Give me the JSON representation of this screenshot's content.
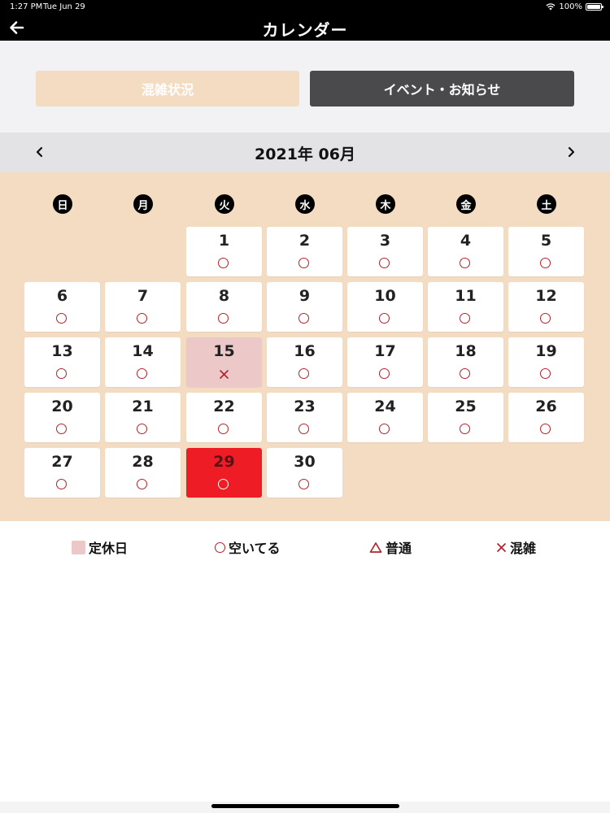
{
  "status_bar": {
    "time": "1:27 PM",
    "date": "Tue Jun 29",
    "battery": "100%",
    "battery_level": 1.0
  },
  "nav": {
    "title": "カレンダー",
    "back_icon": "arrow-left-icon"
  },
  "tabs": [
    {
      "label": "混雑状況",
      "selected": true
    },
    {
      "label": "イベント・お知らせ",
      "selected": false
    }
  ],
  "month": {
    "title": "2021年 06月",
    "prev_icon": "chevron-left-icon",
    "next_icon": "chevron-right-icon"
  },
  "weekdays": [
    "日",
    "月",
    "火",
    "水",
    "木",
    "金",
    "土"
  ],
  "first_weekday_index": 2,
  "days": [
    {
      "day": "1",
      "status": "open"
    },
    {
      "day": "2",
      "status": "open"
    },
    {
      "day": "3",
      "status": "open"
    },
    {
      "day": "4",
      "status": "open"
    },
    {
      "day": "5",
      "status": "open"
    },
    {
      "day": "6",
      "status": "open"
    },
    {
      "day": "7",
      "status": "open"
    },
    {
      "day": "8",
      "status": "open"
    },
    {
      "day": "9",
      "status": "open"
    },
    {
      "day": "10",
      "status": "open"
    },
    {
      "day": "11",
      "status": "open"
    },
    {
      "day": "12",
      "status": "open"
    },
    {
      "day": "13",
      "status": "open"
    },
    {
      "day": "14",
      "status": "open"
    },
    {
      "day": "15",
      "status": "crowded",
      "holiday": true
    },
    {
      "day": "16",
      "status": "open"
    },
    {
      "day": "17",
      "status": "open"
    },
    {
      "day": "18",
      "status": "open"
    },
    {
      "day": "19",
      "status": "open"
    },
    {
      "day": "20",
      "status": "open"
    },
    {
      "day": "21",
      "status": "open"
    },
    {
      "day": "22",
      "status": "open"
    },
    {
      "day": "23",
      "status": "open"
    },
    {
      "day": "24",
      "status": "open"
    },
    {
      "day": "25",
      "status": "open"
    },
    {
      "day": "26",
      "status": "open"
    },
    {
      "day": "27",
      "status": "open"
    },
    {
      "day": "28",
      "status": "open"
    },
    {
      "day": "29",
      "status": "open",
      "today": true
    },
    {
      "day": "30",
      "status": "open"
    }
  ],
  "legend": {
    "holiday": "定休日",
    "open": "空いてる",
    "normal": "普通",
    "crowded": "混雑"
  },
  "colors": {
    "accent_red": "#ee1c24",
    "mark_red": "#b3232b",
    "holiday_pink": "#ecc8c9",
    "calendar_bg": "#f3dcc2",
    "tab_selected": "#f3dcc1",
    "tab_unselected": "#4a4a4c"
  }
}
